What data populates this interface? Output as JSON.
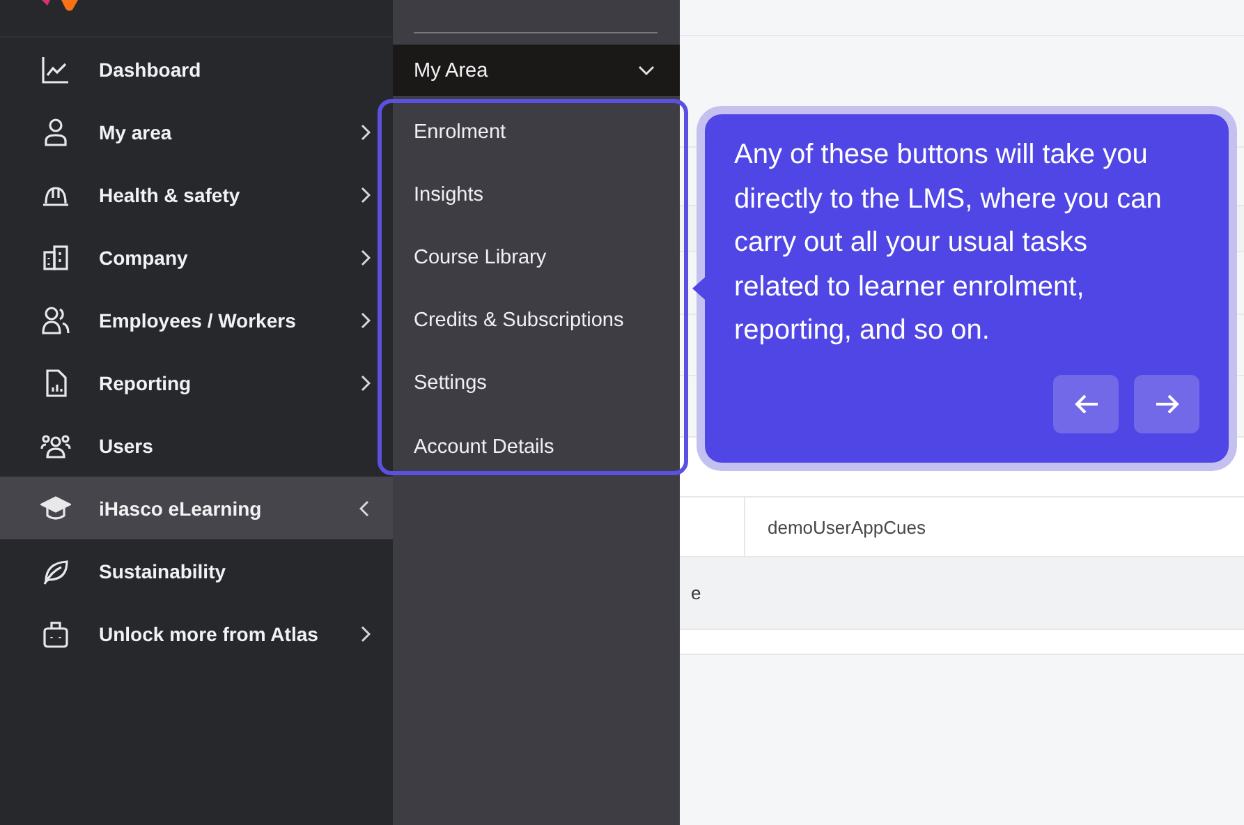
{
  "sidebar": {
    "items": [
      {
        "label": "Dashboard",
        "has_submenu": false,
        "selected": false
      },
      {
        "label": "My area",
        "has_submenu": true,
        "selected": false
      },
      {
        "label": "Health & safety",
        "has_submenu": true,
        "selected": false
      },
      {
        "label": "Company",
        "has_submenu": true,
        "selected": false
      },
      {
        "label": "Employees / Workers",
        "has_submenu": true,
        "selected": false
      },
      {
        "label": "Reporting",
        "has_submenu": true,
        "selected": false
      },
      {
        "label": "Users",
        "has_submenu": false,
        "selected": false
      },
      {
        "label": "iHasco eLearning",
        "has_submenu": true,
        "selected": true
      },
      {
        "label": "Sustainability",
        "has_submenu": false,
        "selected": false
      },
      {
        "label": "Unlock more from Atlas",
        "has_submenu": true,
        "selected": false
      }
    ]
  },
  "submenu": {
    "header": {
      "label": "My Area",
      "expanded": true
    },
    "items": [
      "Enrolment",
      "Insights",
      "Course Library",
      "Credits & Subscriptions",
      "Settings",
      "Account Details"
    ]
  },
  "background": {
    "fragments": [
      "demoUserAppCues",
      "e"
    ]
  },
  "tooltip": {
    "text": "Any of these buttons will take you directly to the LMS, where you can carry out all your usual tasks related to learner enrolment, reporting, and so on."
  }
}
